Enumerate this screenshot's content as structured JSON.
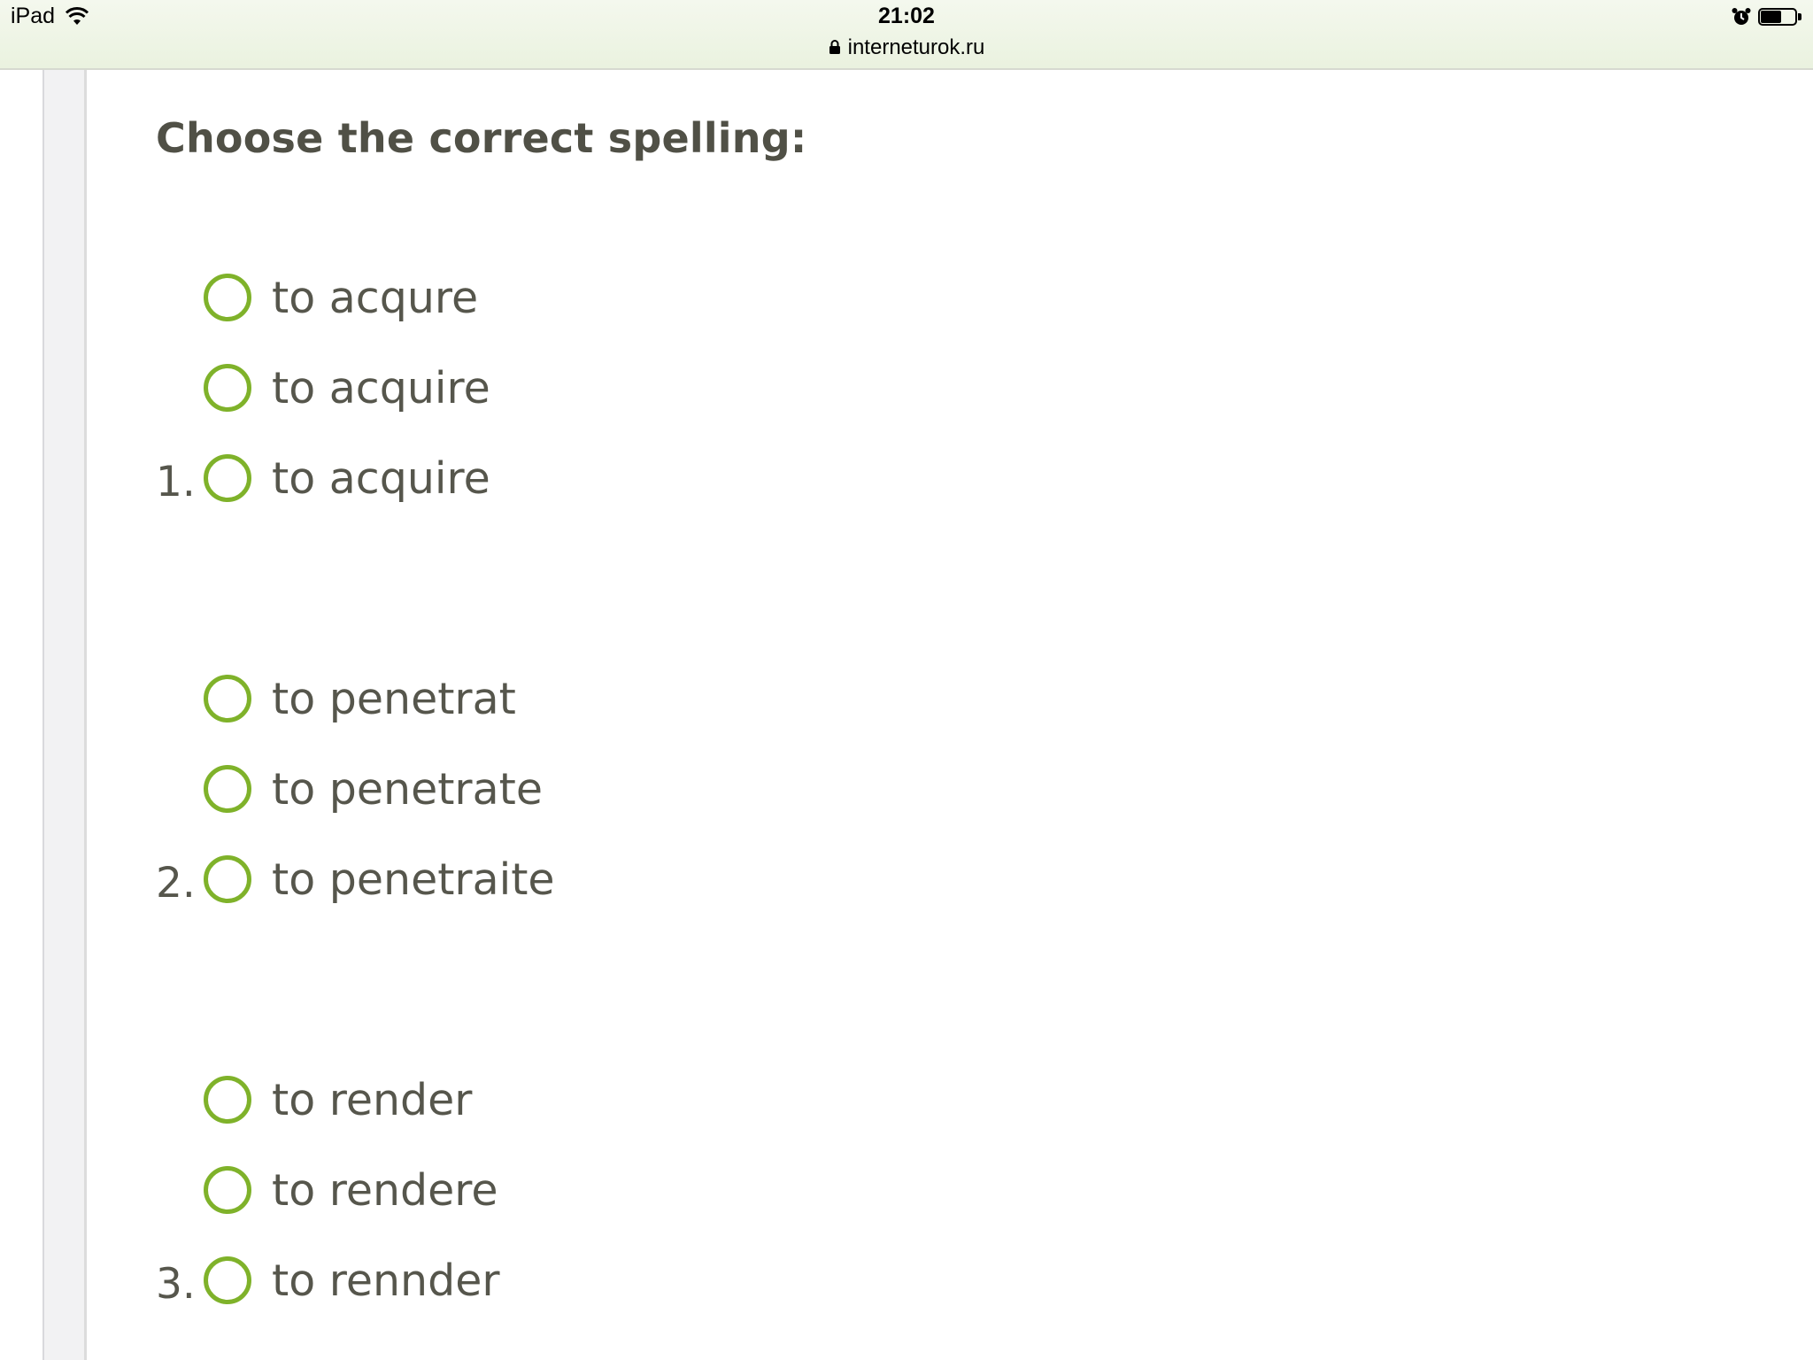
{
  "status_bar": {
    "device": "iPad",
    "time": "21:02",
    "battery_level": 0.6
  },
  "browser": {
    "url": "interneturok.ru"
  },
  "page": {
    "title": "Choose the correct spelling:"
  },
  "questions": [
    {
      "number": "1.",
      "options": [
        "to acqure",
        "to acquire",
        "to acquire"
      ]
    },
    {
      "number": "2.",
      "options": [
        "to penetrat",
        "to penetrate",
        "to penetraite"
      ]
    },
    {
      "number": "3.",
      "options": [
        "to render",
        "to rendere",
        "to rennder"
      ]
    }
  ],
  "colors": {
    "radio_border": "#7fb22a",
    "text": "#56564c"
  }
}
